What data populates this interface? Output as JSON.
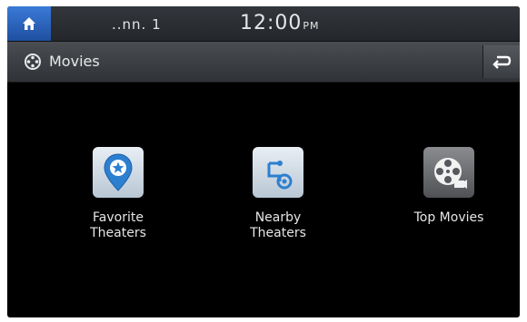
{
  "status_bar": {
    "signal_text": "..nn. 1",
    "clock_time": "12:00",
    "clock_suffix": "PM"
  },
  "title_bar": {
    "title": "Movies",
    "icon": "film-icon",
    "back_icon": "back-arrow-icon"
  },
  "menu": {
    "items": [
      {
        "label": "Favorite\nTheaters",
        "icon": "location-pin-star-icon"
      },
      {
        "label": "Nearby\nTheaters",
        "icon": "route-icon"
      },
      {
        "label": "Top Movies",
        "icon": "film-reel-icon"
      }
    ]
  },
  "colors": {
    "home_button": "#2e66c2",
    "background": "#000000",
    "text": "#e6e6e6",
    "pin_blue": "#2d7fd0"
  }
}
